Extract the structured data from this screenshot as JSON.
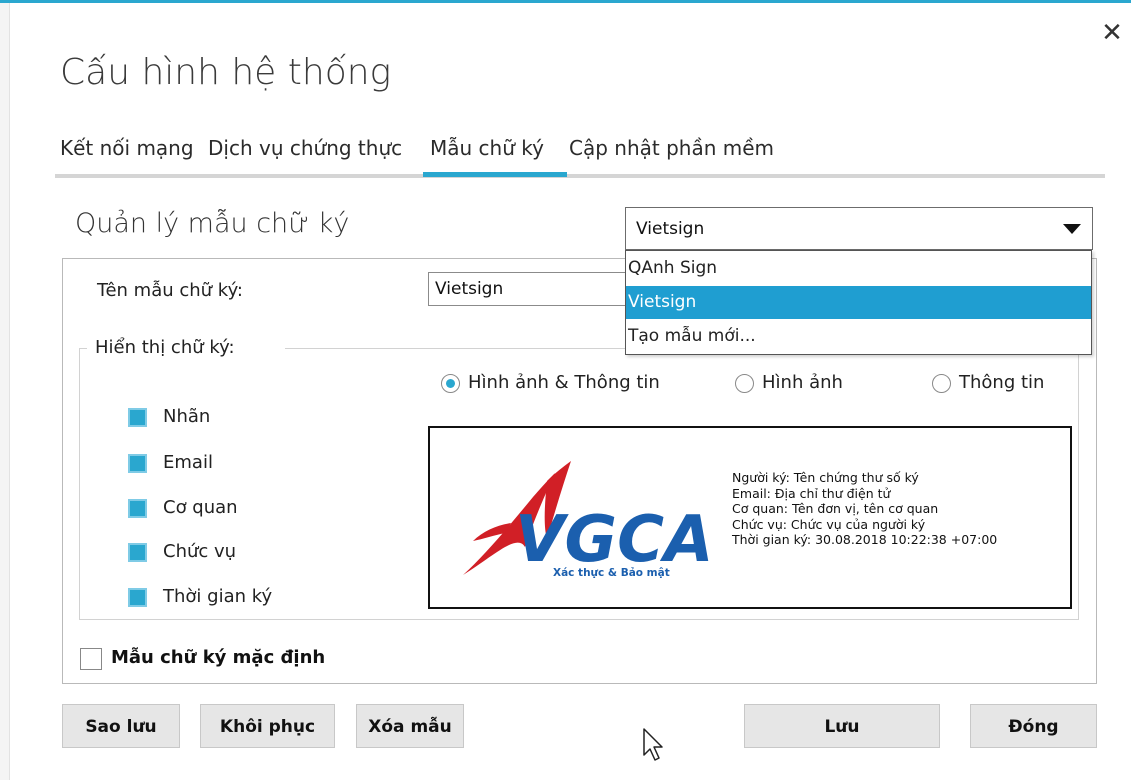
{
  "window": {
    "title": "Cấu hình hệ thống",
    "close_glyph": "✕"
  },
  "tabs": [
    {
      "label": "Kết nối mạng",
      "active": false
    },
    {
      "label": "Dịch vụ chứng thực",
      "active": false
    },
    {
      "label": "Mẫu chữ ký",
      "active": true
    },
    {
      "label": "Cập nhật phần mềm",
      "active": false
    }
  ],
  "section": {
    "title": "Quản lý mẫu chữ ký"
  },
  "template_select": {
    "value": "Vietsign",
    "options": [
      "QAnh Sign",
      "Vietsign",
      "Tạo mẫu mới..."
    ],
    "selected_index": 1
  },
  "form": {
    "name_label": "Tên mẫu chữ ký:",
    "name_value": "Vietsign",
    "display_group_label": "Hiển thị chữ ký:",
    "display_modes": [
      {
        "label": "Hình ảnh & Thông tin",
        "selected": true
      },
      {
        "label": "Hình ảnh",
        "selected": false
      },
      {
        "label": "Thông tin",
        "selected": false
      }
    ],
    "fields": [
      {
        "label": "Nhãn",
        "checked": true
      },
      {
        "label": "Email",
        "checked": true
      },
      {
        "label": "Cơ quan",
        "checked": true
      },
      {
        "label": "Chức vụ",
        "checked": true
      },
      {
        "label": "Thời gian ký",
        "checked": true
      }
    ],
    "default_label": "Mẫu chữ ký mặc định",
    "default_checked": false
  },
  "preview": {
    "logo_text": "VGCA",
    "logo_slogan": "Xác thực & Bảo mật",
    "lines": [
      "Người ký: Tên chứng thư số ký",
      "Email: Địa chỉ thư điện tử",
      "Cơ quan: Tên đơn vị, tên cơ quan",
      "Chức vụ: Chức vụ của người ký",
      "Thời gian ký: 30.08.2018 10:22:38 +07:00"
    ]
  },
  "buttons": {
    "backup": "Sao lưu",
    "restore": "Khôi phục",
    "delete": "Xóa mẫu",
    "save": "Lưu",
    "close": "Đóng"
  },
  "colors": {
    "accent": "#2aa7cf",
    "selection": "#1f9ed1",
    "logo_red": "#d11f26",
    "logo_blue": "#1b5fae"
  }
}
